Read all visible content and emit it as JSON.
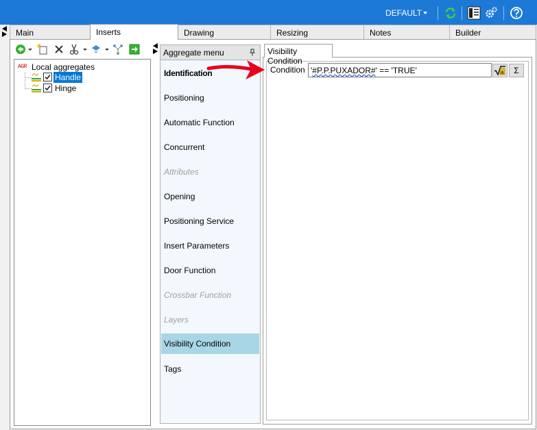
{
  "topbar": {
    "profile": "DEFAULT"
  },
  "tabs": [
    {
      "label": "Main"
    },
    {
      "label": "Inserts"
    },
    {
      "label": "Drawing"
    },
    {
      "label": "Resizing"
    },
    {
      "label": "Notes"
    },
    {
      "label": "Builder"
    }
  ],
  "tree": {
    "root_label": "Local aggregates",
    "root_icon_text": "AGR",
    "children": [
      {
        "label": "Handle",
        "checked": true,
        "selected": true
      },
      {
        "label": "Hinge",
        "checked": true,
        "selected": false
      }
    ]
  },
  "menu": {
    "header": "Aggregate menu",
    "items": [
      {
        "label": "Identification"
      },
      {
        "label": "Positioning"
      },
      {
        "label": "Automatic Function"
      },
      {
        "label": "Concurrent"
      },
      {
        "label": "Attributes"
      },
      {
        "label": "Opening"
      },
      {
        "label": "Positioning Service"
      },
      {
        "label": "Insert Parameters"
      },
      {
        "label": "Door Function"
      },
      {
        "label": "Crossbar Function"
      },
      {
        "label": "Layers"
      },
      {
        "label": "Visibility Condition"
      },
      {
        "label": "Tags"
      }
    ]
  },
  "content": {
    "tab_label": "Visibility Condition",
    "condition_label": "Condition",
    "condition_prefix": "'",
    "condition_var": "#P.P.PUXADOR#",
    "condition_suffix": "' == 'TRUE'",
    "sum_symbol": "Σ"
  },
  "colors": {
    "topbar": "#1c7ad6",
    "selected_menu": "#a9d6e6",
    "tree_selection": "#0078d7",
    "annotation_arrow": "#e8001c"
  }
}
